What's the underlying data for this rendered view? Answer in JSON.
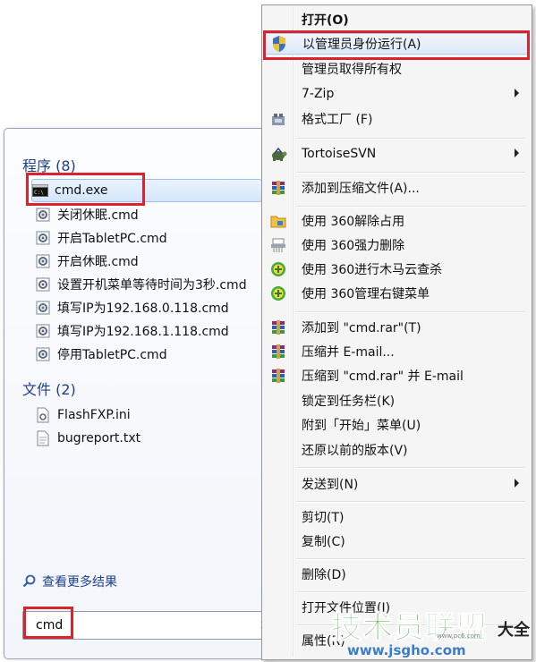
{
  "start_menu": {
    "programs": {
      "title": "程序 (8)",
      "items": [
        {
          "label": "cmd.exe",
          "icon": "cmd-console-icon"
        },
        {
          "label": "关闭休眠.cmd",
          "icon": "cmd-script-icon"
        },
        {
          "label": "开启TabletPC.cmd",
          "icon": "cmd-script-icon"
        },
        {
          "label": "开启休眠.cmd",
          "icon": "cmd-script-icon"
        },
        {
          "label": "设置开机菜单等待时间为3秒.cmd",
          "icon": "cmd-script-icon"
        },
        {
          "label": "填写IP为192.168.0.118.cmd",
          "icon": "cmd-script-icon"
        },
        {
          "label": "填写IP为192.168.1.118.cmd",
          "icon": "cmd-script-icon"
        },
        {
          "label": "停用TabletPC.cmd",
          "icon": "cmd-script-icon"
        }
      ]
    },
    "files": {
      "title": "文件 (2)",
      "items": [
        {
          "label": "FlashFXP.ini",
          "icon": "ini-file-icon"
        },
        {
          "label": "bugreport.txt",
          "icon": "text-file-icon"
        }
      ]
    },
    "see_more": "查看更多结果",
    "search": {
      "value": "cmd",
      "clear_glyph": "x"
    }
  },
  "context_menu": {
    "items": [
      {
        "label": "打开(O)",
        "bold": true
      },
      {
        "label": "以管理员身份运行(A)",
        "icon": "uac-shield-icon"
      },
      {
        "label": "管理员取得所有权"
      },
      {
        "label": "7-Zip",
        "submenu": true
      },
      {
        "label": "格式工厂 (F)",
        "icon": "format-factory-icon"
      },
      {
        "label": "TortoiseSVN",
        "icon": "tortoise-icon",
        "submenu": true
      },
      {
        "label": "添加到压缩文件(A)...",
        "icon": "winrar-icon"
      },
      {
        "label": "使用 360解除占用",
        "icon": "unlock-folder-icon"
      },
      {
        "label": "使用 360强力删除",
        "icon": "shredder-icon"
      },
      {
        "label": "使用 360进行木马云查杀",
        "icon": "shield-360-icon"
      },
      {
        "label": "使用 360管理右键菜单",
        "icon": "shield-360-icon"
      },
      {
        "label": "添加到 \"cmd.rar\"(T)",
        "icon": "winrar-icon"
      },
      {
        "label": "压缩并 E-mail...",
        "icon": "winrar-icon"
      },
      {
        "label": "压缩到 \"cmd.rar\" 并 E-mail",
        "icon": "winrar-icon"
      },
      {
        "label": "锁定到任务栏(K)"
      },
      {
        "label": "附到「开始」菜单(U)"
      },
      {
        "label": "还原以前的版本(V)"
      },
      {
        "label": "发送到(N)",
        "submenu": true
      },
      {
        "label": "剪切(T)"
      },
      {
        "label": "复制(C)"
      },
      {
        "label": "删除(D)"
      },
      {
        "label": "打开文件位置(I)"
      },
      {
        "label": "属性(R)"
      }
    ]
  },
  "watermark": {
    "title": "技术员联盟",
    "url": "www.jsgho.com",
    "suffix": "大全",
    "small": "www.pc6.com"
  },
  "colors": {
    "highlight_border": "#d9232d",
    "group_title": "#1e3f8a",
    "menu_bg": "#f5f5f5",
    "watermark_green": "#3fae37",
    "watermark_blue": "#3b7dc8"
  }
}
